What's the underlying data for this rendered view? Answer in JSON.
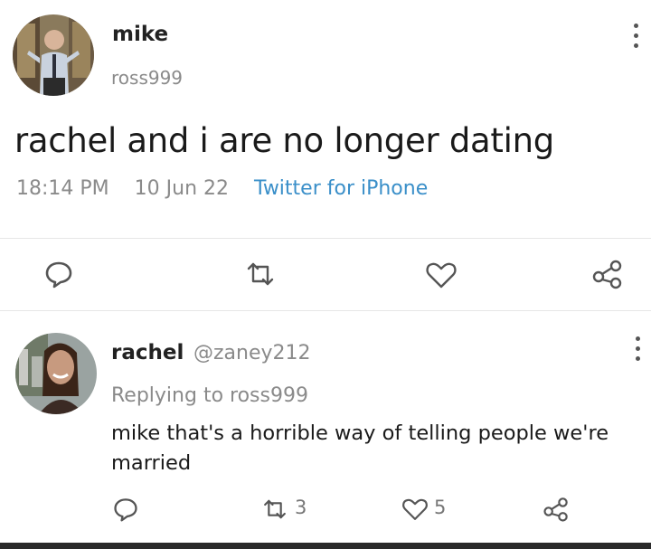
{
  "tweet": {
    "display_name": "mike",
    "handle": "ross999",
    "text": "rachel and i are no longer dating",
    "time": "18:14 PM",
    "date": "10 Jun 22",
    "source": "Twitter for iPhone"
  },
  "reply": {
    "display_name": "rachel",
    "handle": "@zaney212",
    "replying_to": "Replying to ross999",
    "text_line1": "mike that's a horrible way of telling people we're",
    "text_line2": "married",
    "retweet_count": "3",
    "like_count": "5"
  },
  "icons": {
    "tweet_actions": [
      "comment-icon",
      "retweet-icon",
      "heart-icon",
      "share-icon"
    ],
    "reply_actions": [
      "comment-icon",
      "retweet-icon",
      "heart-icon",
      "share-icon"
    ],
    "menu": "more-vertical-icon"
  },
  "colors": {
    "source_link": "#3a8fc9",
    "muted": "#777777"
  }
}
